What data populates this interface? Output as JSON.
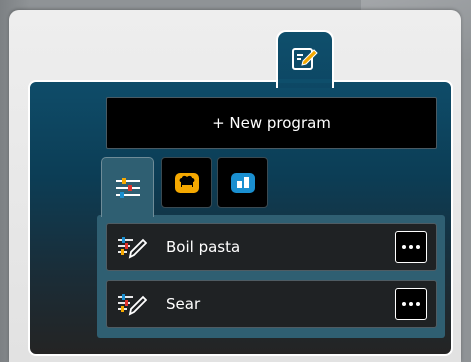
{
  "header": {
    "edit_icon": "edit-program-icon"
  },
  "new_program": {
    "label": "+ New program"
  },
  "category_tabs": [
    {
      "icon": "sliders-icon",
      "active": true
    },
    {
      "icon": "chef-hat-icon",
      "active": false,
      "color": "#f5a800"
    },
    {
      "icon": "oven-mode-icon",
      "active": false,
      "color": "#1a8fd0"
    }
  ],
  "programs": [
    {
      "label": "Boil pasta",
      "icon": "edit-sliders-icon",
      "menu_icon": "more-options-icon"
    },
    {
      "label": "Sear",
      "icon": "edit-sliders-icon",
      "menu_icon": "more-options-icon"
    }
  ],
  "colors": {
    "panel": "#0e4c69",
    "active_tab": "#2f5f72",
    "accent_yellow": "#f5a800",
    "accent_blue": "#1a8fd0",
    "accent_red": "#e0312b"
  }
}
